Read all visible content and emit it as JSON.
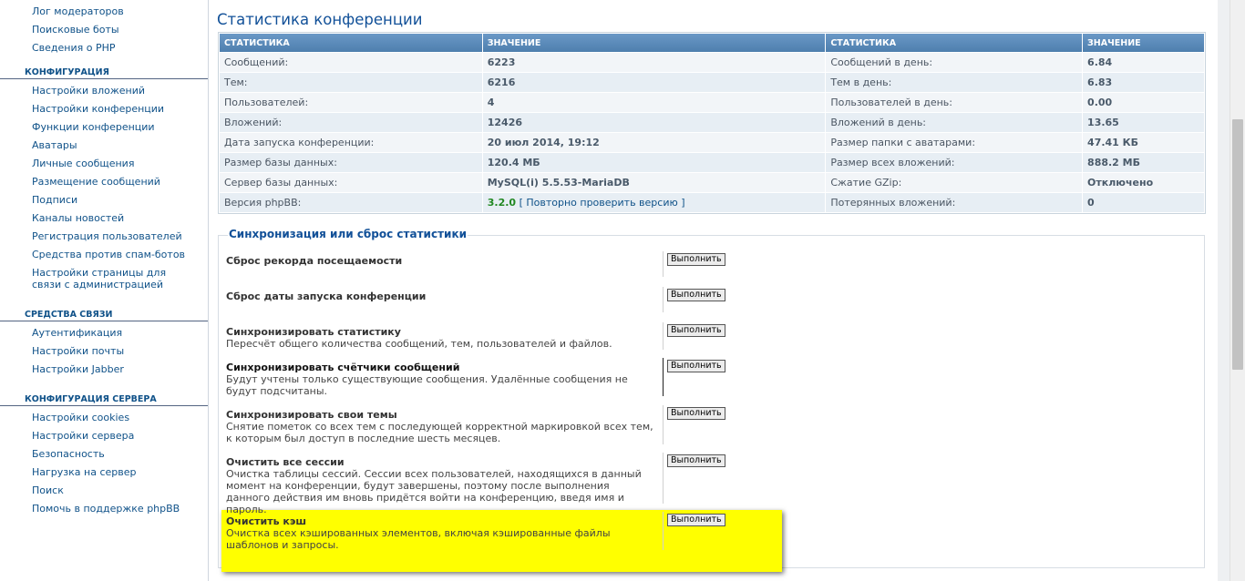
{
  "sidebar": {
    "top_items": [
      "Лог модераторов",
      "Поисковые боты",
      "Сведения о PHP"
    ],
    "sections": [
      {
        "title": "КОНФИГУРАЦИЯ",
        "items": [
          "Настройки вложений",
          "Настройки конференции",
          "Функции конференции",
          "Аватары",
          "Личные сообщения",
          "Размещение сообщений",
          "Подписи",
          "Каналы новостей",
          "Регистрация пользователей",
          "Средства против спам-ботов",
          "Настройки страницы для связи с администрацией"
        ]
      },
      {
        "title": "СРЕДСТВА СВЯЗИ",
        "items": [
          "Аутентификация",
          "Настройки почты",
          "Настройки Jabber"
        ]
      },
      {
        "title": "КОНФИГУРАЦИЯ СЕРВЕРА",
        "items": [
          "Настройки cookies",
          "Настройки сервера",
          "Безопасность",
          "Нагрузка на сервер",
          "Поиск",
          "Помочь в поддержке phpBB"
        ]
      }
    ]
  },
  "main": {
    "title": "Статистика конференции",
    "stats": {
      "headers": [
        "СТАТИСТИКА",
        "ЗНАЧЕНИЕ",
        "СТАТИСТИКА",
        "ЗНАЧЕНИЕ"
      ],
      "rows": [
        [
          "Сообщений:",
          "6223",
          "Сообщений в день:",
          "6.84"
        ],
        [
          "Тем:",
          "6216",
          "Тем в день:",
          "6.83"
        ],
        [
          "Пользователей:",
          "4",
          "Пользователей в день:",
          "0.00"
        ],
        [
          "Вложений:",
          "12426",
          "Вложений в день:",
          "13.65"
        ],
        [
          "Дата запуска конференции:",
          "20 июл 2014, 19:12",
          "Размер папки с аватарами:",
          "47.41 КБ"
        ],
        [
          "Размер базы данных:",
          "120.4 МБ",
          "Размер всех вложений:",
          "888.2 МБ"
        ],
        [
          "Сервер базы данных:",
          "MySQL(i) 5.5.53-MariaDB",
          "Сжатие GZip:",
          "Отключено"
        ]
      ],
      "version_row": {
        "label": "Версия phpBB:",
        "version": "3.2.0",
        "link_open": "[",
        "link_text": "Повторно проверить версию",
        "link_close": "]",
        "right_label": "Потерянных вложений:",
        "right_value": "0"
      }
    },
    "sync": {
      "legend": "Синхронизация или сброс статистики",
      "button_label": "Выполнить",
      "actions": [
        {
          "title": "Сброс рекорда посещаемости",
          "desc": ""
        },
        {
          "title": "Сброс даты запуска конференции",
          "desc": ""
        },
        {
          "title": "Синхронизировать статистику",
          "desc": "Пересчёт общего количества сообщений, тем, пользователей и файлов."
        },
        {
          "title": "Синхронизировать счётчики сообщений",
          "desc": "Будут учтены только существующие сообщения. Удалённые сообщения не будут подсчитаны."
        },
        {
          "title": "Синхронизировать свои темы",
          "desc": "Снятие пометок со всех тем с последующей корректной маркировкой всех тем, к которым был доступ в последние шесть месяцев."
        },
        {
          "title": "Очистить все сессии",
          "desc": "Очистка таблицы сессий. Сессии всех пользователей, находящихся в данный момент на конференции, будут завершены, поэтому после выполнения данного действия им вновь придётся войти на конференцию, введя имя и пароль."
        },
        {
          "title": "Очистить кэш",
          "desc": "Очистка всех кэшированных элементов, включая кэшированные файлы шаблонов и запросы."
        }
      ]
    }
  },
  "colors": {
    "accent": "#105289",
    "header": "#5b8ab9",
    "highlight": "#ffff00",
    "version_ok": "#228822"
  }
}
